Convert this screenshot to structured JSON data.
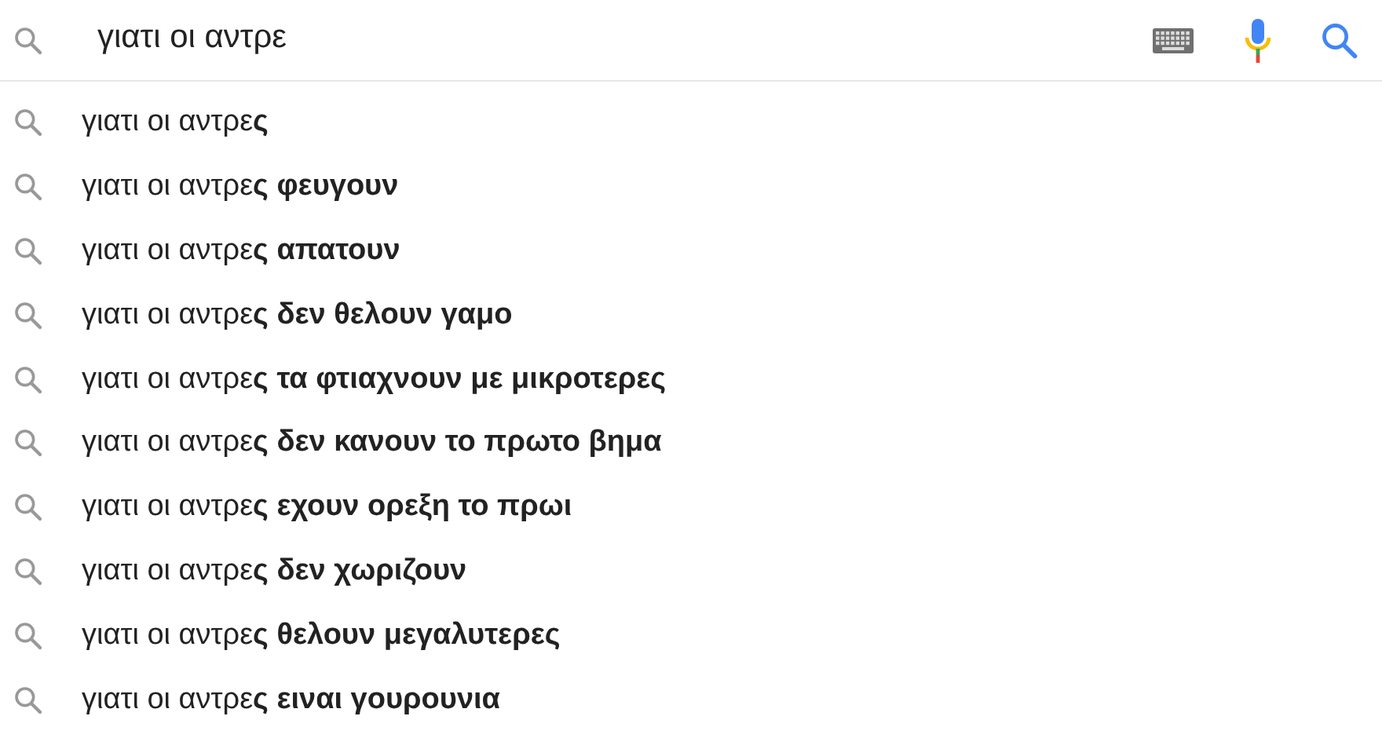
{
  "search": {
    "value": "γιατι οι αντρε"
  },
  "suggestions": [
    "γιατι οι αντρε**ς**",
    "γιατι οι αντρε**ς φευγουν**",
    "γιατι οι αντρε**ς απατουν**",
    "γιατι οι αντρε**ς δεν θελουν γαμο**",
    "γιατι οι αντρε**ς τα φτιαχνουν με μικροτερες**",
    "γιατι οι αντρε**ς δεν κανουν το πρωτο βημα**",
    "γιατι οι αντρε**ς εχουν ορεξη το πρωι**",
    "γιατι οι αντρε**ς δεν χωριζουν**",
    "γιατι οι αντρε**ς θελουν μεγαλυτερες**",
    "γιατι οι αντρε**ς ειναι γουρουνια**"
  ]
}
